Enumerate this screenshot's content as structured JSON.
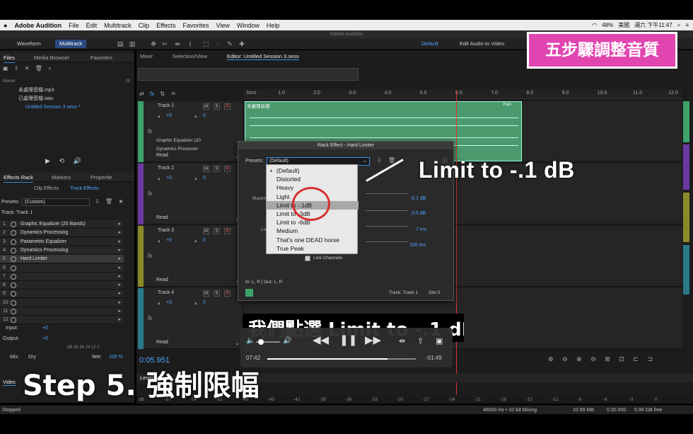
{
  "menubar": {
    "app": "Adobe Audition",
    "items": [
      "File",
      "Edit",
      "Multitrack",
      "Clip",
      "Effects",
      "Favorites",
      "View",
      "Window",
      "Help"
    ],
    "battery": "48%",
    "input_lang": "美國",
    "clock": "週六 下午11:47"
  },
  "window_title": "Adobe Audition",
  "toolbar": {
    "waveform": "Waveform",
    "multitrack": "Multitrack",
    "workspace_default": "Default",
    "workspace_edit_video": "Edit Audio to Video"
  },
  "files_panel": {
    "tabs": [
      "Files",
      "Media Browser",
      "Favorites"
    ],
    "name_header": "Name",
    "status_header": "St",
    "files": [
      "未處理音檔.mp3",
      "已處理音檔.wav",
      "Untitled Session 3.sesx *"
    ]
  },
  "effects_rack": {
    "tabs": [
      "Effects Rack",
      "Markers",
      "Propertie"
    ],
    "subtabs": [
      "Clip Effects",
      "Track Effects"
    ],
    "presets_label": "Presets:",
    "preset_value": "(Custom)",
    "track_label": "Track: Track 1",
    "slots": [
      {
        "num": "1",
        "name": "Graphic Equalizer (20 Bands)"
      },
      {
        "num": "2",
        "name": "Dynamics Processing"
      },
      {
        "num": "3",
        "name": "Parametric Equalizer"
      },
      {
        "num": "4",
        "name": "Dynamics Processing"
      },
      {
        "num": "5",
        "name": "Hard Limiter"
      },
      {
        "num": "6",
        "name": ""
      },
      {
        "num": "7",
        "name": ""
      },
      {
        "num": "8",
        "name": ""
      },
      {
        "num": "9",
        "name": ""
      },
      {
        "num": "10",
        "name": ""
      },
      {
        "num": "11",
        "name": ""
      },
      {
        "num": "12",
        "name": ""
      }
    ],
    "input_label": "Input:",
    "input_val": "+0",
    "output_label": "Output:",
    "output_val": "+0",
    "meter_scale": "dB  48  36  24  12  0",
    "mix_label": "Mix:",
    "dry": "Dry",
    "wet": "Wet",
    "wet_pct": "100 %"
  },
  "editor": {
    "tabs": [
      "Mixer",
      "Selection/View",
      "Editor: Untitled Session 3.sesx"
    ],
    "ruler_unit": "hms",
    "ticks": [
      "1.0",
      "2.0",
      "3.0",
      "4.0",
      "5.0",
      "6.0",
      "7.0",
      "8.0",
      "9.0",
      "10.0",
      "11.0",
      "12.0"
    ],
    "timecode": "0:05.951"
  },
  "tracks": [
    {
      "name": "Track 1",
      "vol": "+0",
      "pan": "0",
      "fx": [
        "Graphic Equalizer (20",
        "Dynamics Processin"
      ],
      "mode": "Read",
      "color": "#3da36a"
    },
    {
      "name": "Track 2",
      "vol": "+0",
      "pan": "0",
      "fx": [
        "",
        ""
      ],
      "mode": "Read",
      "color": "#6a3aa0"
    },
    {
      "name": "Track 3",
      "vol": "+0",
      "pan": "0",
      "fx": [
        "",
        ""
      ],
      "mode": "Read",
      "color": "#8a8a2a"
    },
    {
      "name": "Track 4",
      "vol": "+0",
      "pan": "0",
      "fx": [
        "",
        ""
      ],
      "mode": "Read",
      "color": "#2a7a8a"
    }
  ],
  "clip": {
    "title": "未處理音檔",
    "pan": "Pan"
  },
  "rack_effect": {
    "title": "Rack Effect - Hard Limiter",
    "presets_label": "Presets:",
    "preset_value": "(Default)",
    "labels": [
      "Maxim",
      "Lo"
    ],
    "values": [
      "-0.1 dB",
      "0.0 dB",
      "7 ms",
      "100 ms"
    ],
    "link_channels": "Link Channels",
    "io": "In: L, R | Out: L, R",
    "track": "Track: Track 1",
    "slot": "Slot 5"
  },
  "preset_menu": {
    "items": [
      "(Default)",
      "Distorted",
      "Heavy",
      "Light",
      "Limit to -.1dB",
      "Limit to -3dB",
      "Limit to -6dB",
      "Medium",
      "That's one DEAD horse",
      "True Peak"
    ],
    "checked_index": 0,
    "highlight_index": 4
  },
  "overlays": {
    "sticker": "五步驟調整音質",
    "callout": "Limit to -.1 dB",
    "subtitle": "我們點選 Limit to -.1 dB",
    "step_caption": "Step 5. 強制限幅"
  },
  "player": {
    "elapsed": "07:42",
    "remaining": "-01:49",
    "progress": 0.81,
    "volume": 0.1
  },
  "levels": {
    "label": "Levels",
    "scale": [
      "dB",
      "-57",
      "-54",
      "-51",
      "-48",
      "-45",
      "-42",
      "-39",
      "-36",
      "-33",
      "-30",
      "-27",
      "-24",
      "-21",
      "-18",
      "-15",
      "-12",
      "-9",
      "-6",
      "-3",
      "0"
    ]
  },
  "video_tab": "Video",
  "status": {
    "state": "Stopped",
    "rate": "48000 Hz • 32-bit Mixing",
    "size": "10.99 MB",
    "duration": "0:30.000",
    "free": "5.99 GB free"
  }
}
